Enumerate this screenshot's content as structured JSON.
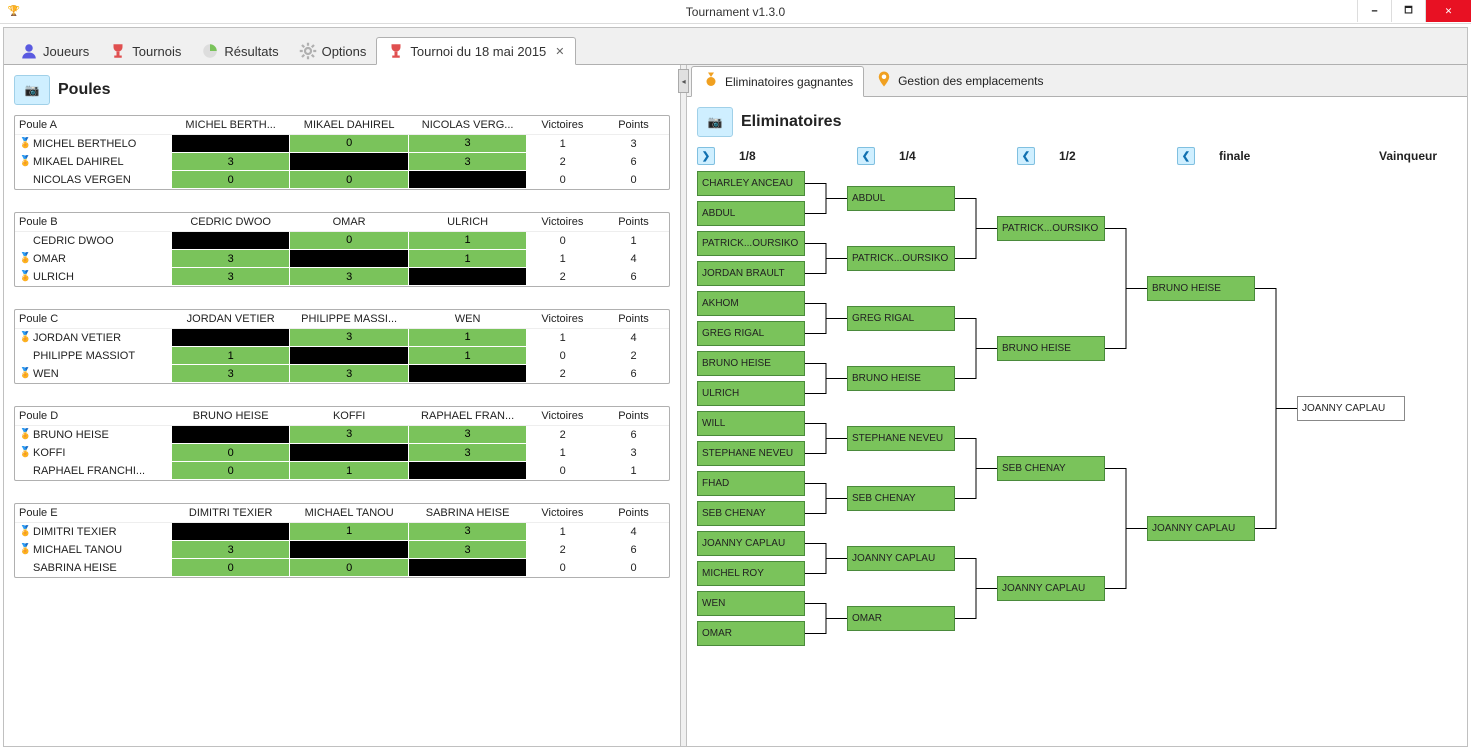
{
  "window": {
    "title": "Tournament v1.3.0"
  },
  "toolbar": {
    "tabs": [
      {
        "label": "Joueurs",
        "icon": "user",
        "color": "#5a5ae0"
      },
      {
        "label": "Tournois",
        "icon": "trophy",
        "color": "#e05050"
      },
      {
        "label": "Résultats",
        "icon": "pie",
        "color": "#7ac35b"
      },
      {
        "label": "Options",
        "icon": "gear",
        "color": "#b0b0b0"
      },
      {
        "label": "Tournoi du 18 mai 2015",
        "icon": "trophy",
        "color": "#e05050",
        "closable": true,
        "active": true
      }
    ]
  },
  "poules_panel": {
    "title": "Poules",
    "columns_tail": [
      "Victoires",
      "Points"
    ],
    "groups": [
      {
        "name": "Poule A",
        "headers": [
          "MICHEL BERTH...",
          "MIKAEL DAHIREL",
          "NICOLAS VERG..."
        ],
        "rows": [
          {
            "medal": "silver",
            "player": "MICHEL BERTHELO",
            "cells": [
              "X",
              "0",
              "3"
            ],
            "vict": "1",
            "pts": "3"
          },
          {
            "medal": "gold",
            "player": "MIKAEL DAHIREL",
            "cells": [
              "3",
              "X",
              "3"
            ],
            "vict": "2",
            "pts": "6"
          },
          {
            "medal": "none",
            "player": "NICOLAS VERGEN",
            "cells": [
              "0",
              "0",
              "X"
            ],
            "vict": "0",
            "pts": "0"
          }
        ]
      },
      {
        "name": "Poule B",
        "headers": [
          "CEDRIC DWOO",
          "OMAR",
          "ULRICH"
        ],
        "rows": [
          {
            "medal": "none",
            "player": "CEDRIC DWOO",
            "cells": [
              "X",
              "0",
              "1"
            ],
            "vict": "0",
            "pts": "1"
          },
          {
            "medal": "silver",
            "player": "OMAR",
            "cells": [
              "3",
              "X",
              "1"
            ],
            "vict": "1",
            "pts": "4"
          },
          {
            "medal": "gold",
            "player": "ULRICH",
            "cells": [
              "3",
              "3",
              "X"
            ],
            "vict": "2",
            "pts": "6"
          }
        ]
      },
      {
        "name": "Poule C",
        "headers": [
          "JORDAN VETIER",
          "PHILIPPE MASSI...",
          "WEN"
        ],
        "rows": [
          {
            "medal": "silver",
            "player": "JORDAN VETIER",
            "cells": [
              "X",
              "3",
              "1"
            ],
            "vict": "1",
            "pts": "4"
          },
          {
            "medal": "none",
            "player": "PHILIPPE MASSIOT",
            "cells": [
              "1",
              "X",
              "1"
            ],
            "vict": "0",
            "pts": "2"
          },
          {
            "medal": "gold",
            "player": "WEN",
            "cells": [
              "3",
              "3",
              "X"
            ],
            "vict": "2",
            "pts": "6"
          }
        ]
      },
      {
        "name": "Poule D",
        "headers": [
          "BRUNO HEISE",
          "KOFFI",
          "RAPHAEL FRAN..."
        ],
        "rows": [
          {
            "medal": "gold",
            "player": "BRUNO HEISE",
            "cells": [
              "X",
              "3",
              "3"
            ],
            "vict": "2",
            "pts": "6"
          },
          {
            "medal": "silver",
            "player": "KOFFI",
            "cells": [
              "0",
              "X",
              "3"
            ],
            "vict": "1",
            "pts": "3"
          },
          {
            "medal": "none",
            "player": "RAPHAEL FRANCHI...",
            "cells": [
              "0",
              "1",
              "X"
            ],
            "vict": "0",
            "pts": "1"
          }
        ]
      },
      {
        "name": "Poule E",
        "headers": [
          "DIMITRI TEXIER",
          "MICHAEL TANOU",
          "SABRINA HEISE"
        ],
        "rows": [
          {
            "medal": "silver",
            "player": "DIMITRI TEXIER",
            "cells": [
              "X",
              "1",
              "3"
            ],
            "vict": "1",
            "pts": "4"
          },
          {
            "medal": "gold",
            "player": "MICHAEL TANOU",
            "cells": [
              "3",
              "X",
              "3"
            ],
            "vict": "2",
            "pts": "6"
          },
          {
            "medal": "none",
            "player": "SABRINA HEISE",
            "cells": [
              "0",
              "0",
              "X"
            ],
            "vict": "0",
            "pts": "0"
          }
        ]
      }
    ]
  },
  "right_tabs": [
    {
      "label": "Eliminatoires gagnantes",
      "icon": "medal",
      "color": "#f0a020",
      "active": true
    },
    {
      "label": "Gestion des emplacements",
      "icon": "marker",
      "color": "#f0a020"
    }
  ],
  "bracket": {
    "title": "Eliminatoires",
    "rounds": [
      {
        "label": "1/8",
        "arrow": "right"
      },
      {
        "label": "1/4",
        "arrow": "left"
      },
      {
        "label": "1/2",
        "arrow": "left"
      },
      {
        "label": "finale",
        "arrow": "left"
      },
      {
        "label": "Vainqueur",
        "arrow": "none"
      }
    ],
    "r16": [
      "CHARLEY ANCEAU",
      "ABDUL",
      "PATRICK...OURSIKO",
      "JORDAN BRAULT",
      "AKHOM",
      "GREG RIGAL",
      "BRUNO HEISE",
      "ULRICH",
      "WILL",
      "STEPHANE NEVEU",
      "FHAD",
      "SEB CHENAY",
      "JOANNY CAPLAU",
      "MICHEL ROY",
      "WEN",
      "OMAR"
    ],
    "r8": [
      "ABDUL",
      "PATRICK...OURSIKO",
      "GREG RIGAL",
      "BRUNO HEISE",
      "STEPHANE NEVEU",
      "SEB CHENAY",
      "JOANNY CAPLAU",
      "OMAR"
    ],
    "r4": [
      "PATRICK...OURSIKO",
      "BRUNO HEISE",
      "SEB CHENAY",
      "JOANNY CAPLAU"
    ],
    "r2": [
      "BRUNO HEISE",
      "JOANNY CAPLAU"
    ],
    "winner": "JOANNY CAPLAU"
  }
}
